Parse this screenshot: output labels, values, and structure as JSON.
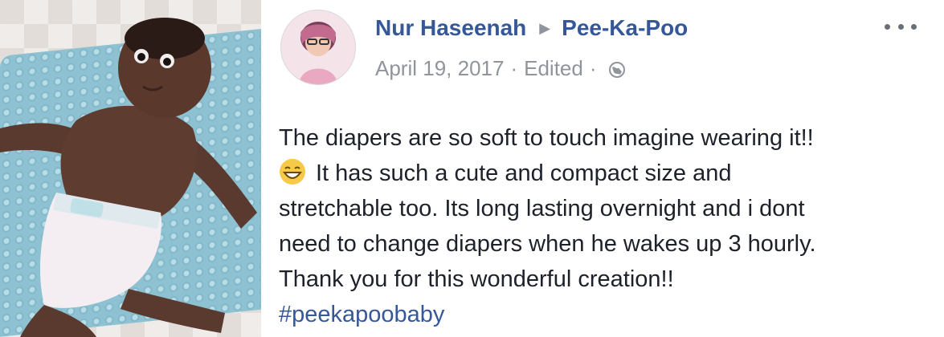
{
  "photo": {
    "subject": "baby-on-changing-pad"
  },
  "post": {
    "author": "Nur Haseenah",
    "target": "Pee-Ka-Poo",
    "date": "April 19, 2017",
    "edited": "Edited",
    "separator": "·",
    "privacy_icon": "globe-icon",
    "more_icon": "more-options-icon",
    "body_lines": [
      "The diapers are so soft to touch imagine wearing it!!",
      "It has such a cute and compact size and",
      "stretchable too. Its long lasting overnight and i dont",
      "need to change diapers when he wakes up 3 hourly.",
      "Thank you for this wonderful creation!!"
    ],
    "emoji": "grinning-face-icon",
    "hashtag": "#peekapoobaby"
  },
  "colors": {
    "link": "#365899",
    "meta": "#90949c",
    "text": "#1d2129"
  }
}
